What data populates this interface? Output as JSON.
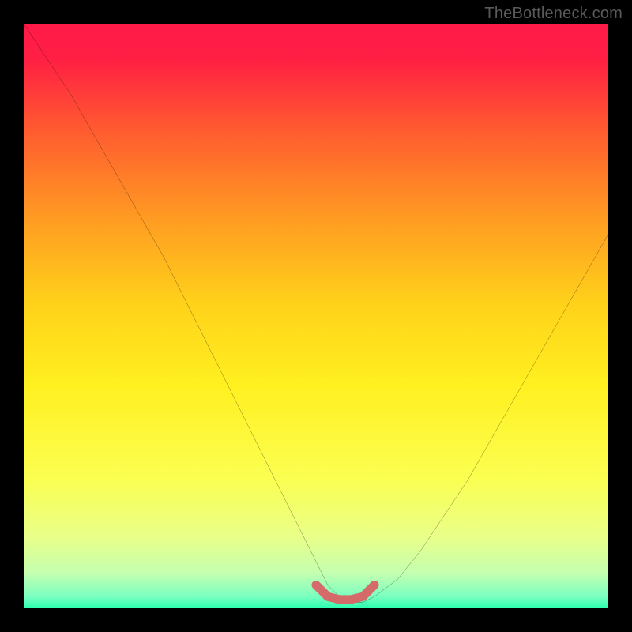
{
  "watermark": "TheBottleneck.com",
  "chart_data": {
    "type": "line",
    "title": "",
    "xlabel": "",
    "ylabel": "",
    "xlim": [
      0,
      100
    ],
    "ylim": [
      0,
      100
    ],
    "background_gradient": {
      "stops": [
        {
          "pct": 0,
          "color": "#ff1a49"
        },
        {
          "pct": 6,
          "color": "#ff1f43"
        },
        {
          "pct": 18,
          "color": "#ff5a30"
        },
        {
          "pct": 33,
          "color": "#ff9a22"
        },
        {
          "pct": 48,
          "color": "#ffd21a"
        },
        {
          "pct": 62,
          "color": "#fff020"
        },
        {
          "pct": 78,
          "color": "#fbff52"
        },
        {
          "pct": 88,
          "color": "#e8ff8a"
        },
        {
          "pct": 94,
          "color": "#c4ffb0"
        },
        {
          "pct": 98,
          "color": "#7affc0"
        },
        {
          "pct": 100,
          "color": "#29ffaf"
        }
      ]
    },
    "curve": {
      "x": [
        0,
        4,
        8,
        12,
        16,
        20,
        24,
        28,
        32,
        36,
        40,
        44,
        48,
        50,
        52,
        54,
        56,
        58,
        60,
        64,
        68,
        72,
        76,
        80,
        84,
        88,
        92,
        96,
        100
      ],
      "y": [
        100,
        94,
        88,
        81,
        74,
        67,
        60,
        52,
        44,
        36,
        28,
        20,
        12,
        8,
        4,
        2,
        1,
        1,
        2,
        5,
        10,
        16,
        22,
        29,
        36,
        43,
        50,
        57,
        64
      ]
    },
    "highlight_segment": {
      "color": "#d46a6a",
      "width": 10,
      "x": [
        50,
        52,
        54,
        56,
        58,
        60
      ],
      "y": [
        4,
        2,
        1.5,
        1.5,
        2,
        4
      ]
    }
  }
}
